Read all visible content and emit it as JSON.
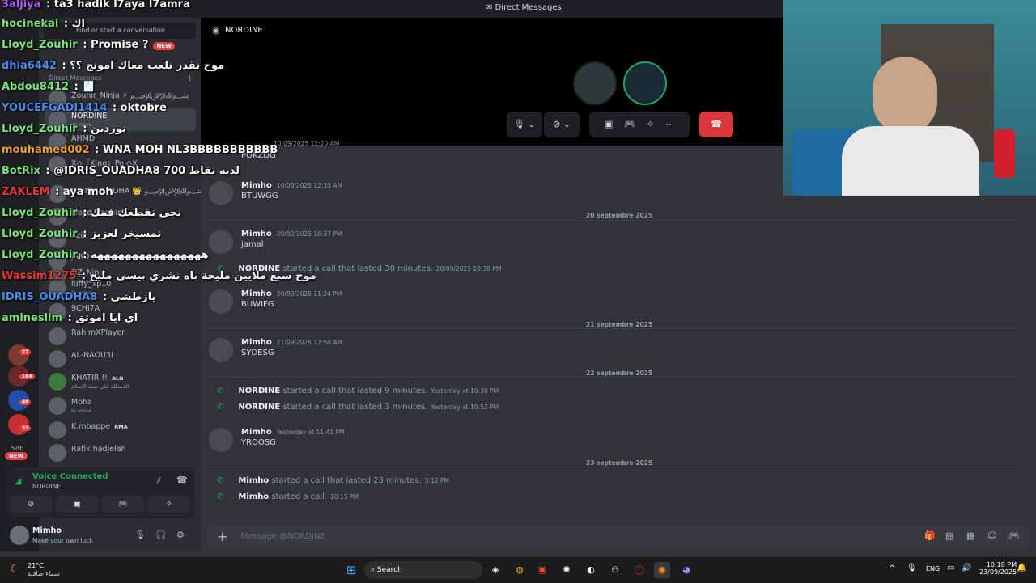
{
  "window": {
    "title": "Direct Messages"
  },
  "sidebar": {
    "search_placeholder": "Find or start a conversation",
    "dm_header": "Direct Messages",
    "dms": [
      {
        "name": "Zouhir_Ninja ⚡ ﷽",
        "sub": ""
      },
      {
        "name": "NORDINE",
        "sub": "In voice"
      },
      {
        "name": "AHMD",
        "sub": ""
      },
      {
        "name": "X◇『King』Po ◇X",
        "sub": ""
      },
      {
        "name": "IDRIS_OUADHA 👑 ﷽",
        "sub": ""
      },
      {
        "name": "Lloyd_Zouhir",
        "sub": ""
      },
      {
        "name": "Aziz",
        "sub": ""
      },
      {
        "name": "JAKO",
        "sub": ""
      },
      {
        "name": "DZ_Ninja",
        "sub": "In voice"
      },
      {
        "name": "luffy_xp10",
        "sub": "In voice"
      },
      {
        "name": "9CHI7A",
        "sub": ""
      },
      {
        "name": "RahimXPlayer",
        "sub": ""
      },
      {
        "name": "AL-NAOU3I",
        "sub": ""
      },
      {
        "name": "KHATIR !!",
        "tag": "ALG",
        "sub": "الحمدلله على نعمة الإسلام"
      },
      {
        "name": "Moha",
        "sub": "In voice"
      },
      {
        "name": "K.mbappe",
        "tag": "RMA",
        "sub": ""
      },
      {
        "name": "Rafik hadjelah",
        "sub": ""
      }
    ]
  },
  "rail": {
    "badges": [
      "1K+",
      "27",
      "164",
      "48",
      "33",
      "NEW"
    ],
    "rail_label": "Sdb"
  },
  "voice": {
    "status": "Voice Connected",
    "channel": "NORDINE"
  },
  "user": {
    "name": "Mimho",
    "status": "Make your own luck"
  },
  "call": {
    "name": "NORDINE"
  },
  "chat": {
    "partial_top": {
      "text": "POKZDG",
      "timestamp": "10/09/2025 12:20 AM"
    },
    "messages": [
      {
        "author": "Mimho",
        "timestamp": "10/09/2025 12:33 AM",
        "text": "BTUWGG"
      },
      {
        "divider": "20 septembre 2025"
      },
      {
        "author": "Mimho",
        "timestamp": "20/09/2025 10:37 PM",
        "text": "jamal"
      },
      {
        "system": true,
        "who": "NORDINE",
        "text": "started a call that lasted 30 minutes.",
        "timestamp": "20/09/2025 10:38 PM"
      },
      {
        "author": "Mimho",
        "timestamp": "20/09/2025 11:24 PM",
        "text": "BUWIFG"
      },
      {
        "divider": "21 septembre 2025"
      },
      {
        "author": "Mimho",
        "timestamp": "21/09/2025 12:50 AM",
        "text": "SYDESG"
      },
      {
        "divider": "22 septembre 2025"
      },
      {
        "system": true,
        "who": "NORDINE",
        "text": "started a call that lasted 9 minutes.",
        "timestamp": "Yesterday at 10:30 PM"
      },
      {
        "system": true,
        "who": "NORDINE",
        "text": "started a call that lasted 3 minutes.",
        "timestamp": "Yesterday at 10:52 PM"
      },
      {
        "author": "Mimho",
        "timestamp": "Yesterday at 11:41 PM",
        "text": "YROOSG"
      },
      {
        "divider": "23 septembre 2025"
      },
      {
        "system": true,
        "who": "Mimho",
        "text": "started a call that lasted 23 minutes.",
        "timestamp": "3:12 PM"
      },
      {
        "system": true,
        "who": "Mimho",
        "text": "started a call.",
        "timestamp": "10:15 PM"
      }
    ],
    "composer_placeholder": "Message @NORDINE"
  },
  "overlay_chat": [
    {
      "user": "3aljiya",
      "color": "#b05cf0",
      "text": ": ta3 hadik l7aya l7amra"
    },
    {
      "user": "hocinekai",
      "color": "#7de37d",
      "text": ": اك"
    },
    {
      "user": "Lloyd_Zouhir",
      "color": "#7de37d",
      "text": ": Promise ?"
    },
    {
      "user": "dhia6442",
      "color": "#4a8cf0",
      "text": ": موح نقدر نلعب معاك امونج ؟؟"
    },
    {
      "user": "Abdou8412",
      "color": "#7de37d",
      "text": ": 🧾"
    },
    {
      "user": "YOUCEFGADI1414",
      "color": "#4a8cf0",
      "text": ": oktobre"
    },
    {
      "user": "Lloyd_Zouhir",
      "color": "#7de37d",
      "text": ": نوردين"
    },
    {
      "user": "mouhamed002",
      "color": "#f0a030",
      "text": ": WNA MOH NL3BBBBBBBBBBB"
    },
    {
      "user": "BotRix",
      "color": "#7de37d",
      "text": ": @IDRIS_OUADHA8 700 لديه نقاط"
    },
    {
      "user": "ZAKLEM",
      "color": "#e83a3a",
      "text": ": aya moh"
    },
    {
      "user": "Lloyd_Zouhir",
      "color": "#7de37d",
      "text": ": نجي نقطعك فمك"
    },
    {
      "user": "Lloyd_Zouhir",
      "color": "#7de37d",
      "text": ": تمسيخر لعزيز"
    },
    {
      "user": "Lloyd_Zouhir",
      "color": "#7de37d",
      "text": ": ههههههههههههههههه"
    },
    {
      "user": "Wassim1275",
      "color": "#e83a3a",
      "text": ": موح سبع ملايين مليحة باه نشري بيسي مليح"
    },
    {
      "user": "IDRIS_OUADHA8",
      "color": "#4a8cf0",
      "text": ": يازطشي"
    },
    {
      "user": "amineslim",
      "color": "#7de37d",
      "text": ": اي ايا اموتق"
    }
  ],
  "overlay_new_badge": "NEW",
  "taskbar": {
    "weather_temp": "21°C",
    "weather_desc": "سماء صافية",
    "search_label": "Search",
    "lang": "ENG",
    "time": "10:18 PM",
    "date": "23/09/2025"
  },
  "colors": {
    "accent": "#5865f2",
    "online": "#23a55a",
    "danger": "#da373c"
  }
}
